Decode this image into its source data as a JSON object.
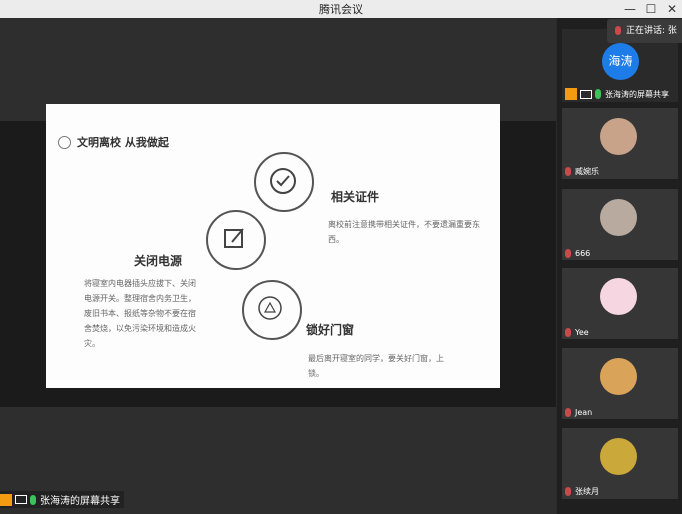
{
  "window": {
    "title": "腾讯会议",
    "minimize": "—",
    "maximize": "☐",
    "close": "✕"
  },
  "speaking": {
    "label": "正在讲话: 张"
  },
  "share": {
    "label": "张海涛的屏幕共享"
  },
  "slide": {
    "heading": "文明离校 从我做起",
    "items": [
      {
        "title": "相关证件",
        "desc": "离校前注意携带相关证件，不要遗漏重要东西。"
      },
      {
        "title": "关闭电源",
        "desc": "将寝室内电器插头应拔下、关闭电源开关。整理宿舍内务卫生，废旧书本、报纸等杂物不要在宿舍焚烧，以免污染环境和造成火灾。"
      },
      {
        "title": "锁好门窗",
        "desc": "最后离开寝室的同学，要关好门窗，上锁。"
      }
    ]
  },
  "participants": [
    {
      "name": "张海涛的屏幕共享",
      "avatar_text": "海涛",
      "avatar_color": "#1e7ce8"
    },
    {
      "name": "臧婉乐",
      "avatar_color": "#c9a28a"
    },
    {
      "name": "666",
      "avatar_color": "#b9aaa0"
    },
    {
      "name": "Yee",
      "avatar_color": "#f5d6e1"
    },
    {
      "name": "Jean",
      "avatar_color": "#d9a45a"
    },
    {
      "name": "张续月",
      "avatar_color": "#caa83a"
    }
  ]
}
